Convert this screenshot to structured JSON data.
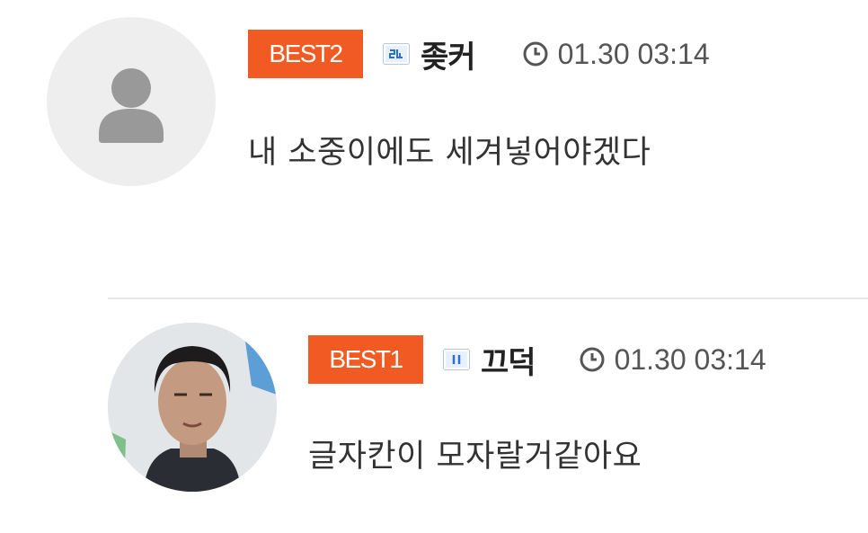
{
  "comments": [
    {
      "best_label": "BEST2",
      "level_icon": "level-badge-icon",
      "nickname": "좆커",
      "time": "01.30 03:14",
      "avatar": "default-person-icon",
      "text": "내 소중이에도 세겨넣어야겠다"
    },
    {
      "best_label": "BEST1",
      "level_icon": "level-badge-icon",
      "nickname": "끄덕",
      "time": "01.30 03:14",
      "avatar": "user-photo",
      "text": "글자칸이 모자랄거같아요"
    }
  ],
  "colors": {
    "best_badge": "#f15a22",
    "level_icon": "#2a6fd6",
    "divider": "#e9e9e9",
    "avatar_placeholder": "#eeeeee"
  }
}
